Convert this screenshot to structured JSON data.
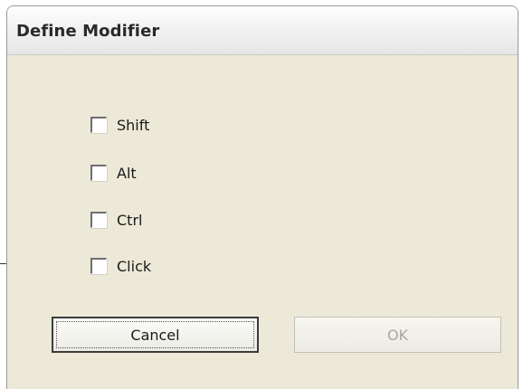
{
  "dialog": {
    "title": "Define Modifier",
    "checkboxes": [
      {
        "label": "Shift",
        "checked": false
      },
      {
        "label": "Alt",
        "checked": false
      },
      {
        "label": "Ctrl",
        "checked": false
      },
      {
        "label": "Click",
        "checked": false
      }
    ],
    "buttons": {
      "cancel_label": "Cancel",
      "ok_label": "OK",
      "ok_enabled": false
    }
  }
}
